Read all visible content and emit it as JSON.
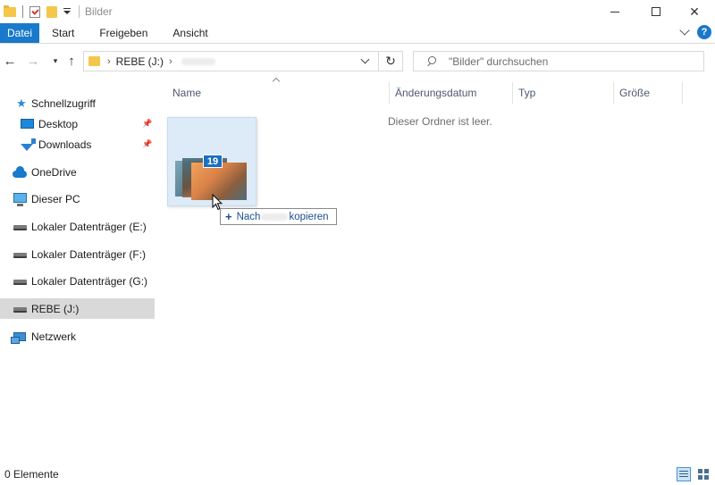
{
  "window": {
    "title": "Bilder",
    "controls": {
      "minimize": "minimize",
      "maximize": "maximize",
      "close": "✕"
    }
  },
  "ribbon": {
    "tabs": [
      {
        "label": "Datei"
      },
      {
        "label": "Start"
      },
      {
        "label": "Freigeben"
      },
      {
        "label": "Ansicht"
      }
    ],
    "help": "?"
  },
  "address": {
    "crumbs": [
      "REBE (J:)"
    ],
    "search_placeholder": "\"Bilder\" durchsuchen"
  },
  "navpane": {
    "items": [
      {
        "label": "Schnellzugriff",
        "icon": "star-icon"
      },
      {
        "label": "Desktop",
        "icon": "desktop-icon",
        "pinned": true
      },
      {
        "label": "Downloads",
        "icon": "download-icon",
        "pinned": true
      },
      {
        "label": "OneDrive",
        "icon": "cloud-icon"
      },
      {
        "label": "Dieser PC",
        "icon": "computer-icon"
      },
      {
        "label": "Lokaler Datenträger (E:)",
        "icon": "drive-icon"
      },
      {
        "label": "Lokaler Datenträger (F:)",
        "icon": "drive-icon"
      },
      {
        "label": "Lokaler Datenträger (G:)",
        "icon": "drive-icon"
      },
      {
        "label": "REBE (J:)",
        "icon": "drive-icon",
        "selected": true
      },
      {
        "label": "Netzwerk",
        "icon": "network-icon"
      }
    ]
  },
  "content": {
    "columns": [
      "Name",
      "Änderungsdatum",
      "Typ",
      "Größe"
    ],
    "empty_message": "Dieser Ordner ist leer."
  },
  "drag": {
    "count": "19",
    "tooltip_prefix": "Nach",
    "tooltip_suffix": "kopieren"
  },
  "status": {
    "item_count": "0 Elemente"
  },
  "colors": {
    "accent": "#1979ca",
    "selected_bg": "#d9d9d9"
  }
}
